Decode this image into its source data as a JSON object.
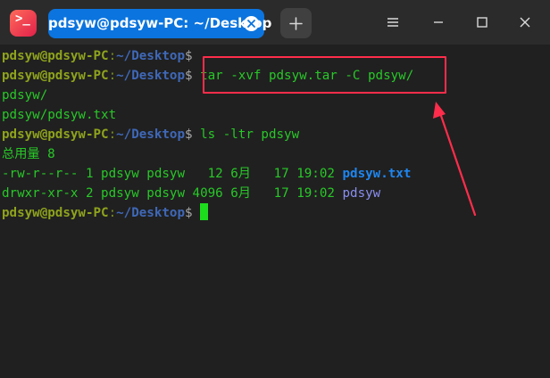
{
  "app": {
    "icon": "terminal-icon",
    "icon_glyph": ">_"
  },
  "tab": {
    "title": "pdsyw@pdsyw-PC: ~/Desktop"
  },
  "window_controls": [
    "menu-icon",
    "minimize-icon",
    "maximize-icon",
    "close-icon"
  ],
  "terminal": {
    "prompt": {
      "user": "pdsyw@pdsyw-PC",
      "colon": ":",
      "path": "~/Desktop",
      "dollar": "$"
    },
    "lines": [
      {
        "type": "prompt",
        "command": ""
      },
      {
        "type": "prompt",
        "command": " tar -xvf pdsyw.tar -C pdsyw/"
      },
      {
        "type": "output",
        "text": "pdsyw/"
      },
      {
        "type": "output",
        "text": "pdsyw/pdsyw.txt"
      },
      {
        "type": "prompt",
        "command": " ls -ltr pdsyw"
      },
      {
        "type": "output",
        "text": "总用量 8"
      },
      {
        "type": "listing",
        "meta": "-rw-r--r-- 1 pdsyw pdsyw   12 6月   17 19:02 ",
        "name": "pdsyw.txt"
      },
      {
        "type": "listing",
        "meta": "drwxr-xr-x 2 pdsyw pdsyw 4096 6月   17 19:02 ",
        "name": "pdsyw"
      },
      {
        "type": "prompt",
        "command": " "
      }
    ]
  },
  "colors": {
    "accent": "#0b74de",
    "annotation": "#ff2d4b",
    "background": "#202020"
  }
}
